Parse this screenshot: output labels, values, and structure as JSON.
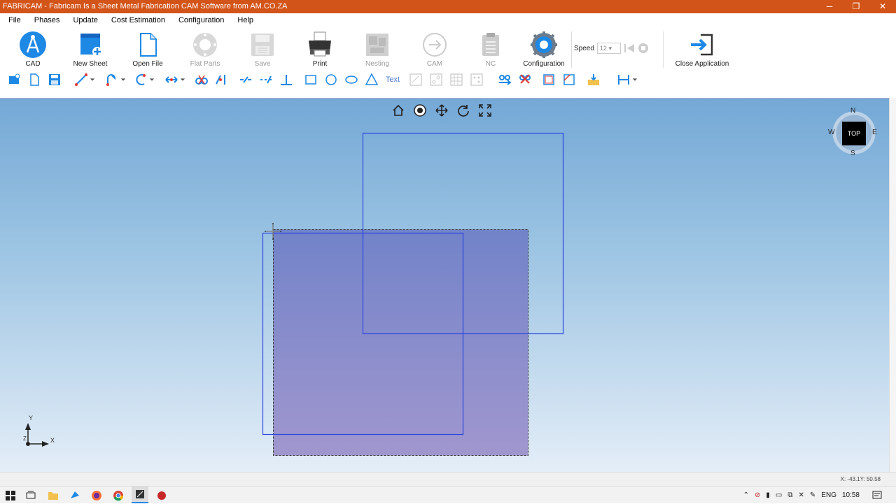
{
  "window": {
    "title": "FABRICAM - Fabricam Is a Sheet Metal Fabrication CAM Software from AM.CO.ZA",
    "minimize": "─",
    "restore": "❐",
    "close": "✕"
  },
  "menu": [
    "File",
    "Phases",
    "Update",
    "Cost Estimation",
    "Configuration",
    "Help"
  ],
  "ribbon": {
    "cad": "CAD",
    "new_sheet": "New Sheet",
    "open_file": "Open File",
    "flat_parts": "Flat Parts",
    "save": "Save",
    "print": "Print",
    "nesting": "Nesting",
    "cam": "CAM",
    "nc": "NC",
    "configuration": "Configuration",
    "speed_label": "Speed",
    "speed_value": "12",
    "close_application": "Close Application"
  },
  "toolbar": {
    "text_tool": "Text"
  },
  "viewcube": {
    "n": "N",
    "s": "S",
    "e": "E",
    "w": "W",
    "top": "TOP"
  },
  "axes": {
    "x": "X",
    "y": "Y",
    "z": "Z"
  },
  "status": {
    "coords": "X: -43.1Y: 50.58"
  },
  "taskbar": {
    "lang": "ENG",
    "time": "10:58"
  },
  "colors": {
    "titlebar": "#d35418",
    "canvas_top": "#74a8d6",
    "shape_stroke": "#2d46e0",
    "selection_fill": "#7a7fc8"
  }
}
